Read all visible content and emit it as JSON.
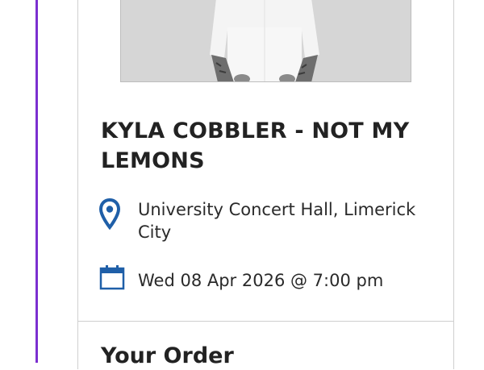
{
  "event": {
    "title": "KYLA COBBLER - NOT MY LEMONS",
    "venue": "University Concert Hall, Limerick City",
    "datetime": "Wed 08 Apr 2026 @ 7:00 pm"
  },
  "order": {
    "heading": "Your Order"
  },
  "icons": {
    "venue": "location-pin-icon",
    "date": "calendar-icon"
  },
  "colors": {
    "accent": "#7b2fd0",
    "icon_blue": "#1f5fa8",
    "text": "#222222",
    "divider": "#cfcfcf"
  }
}
